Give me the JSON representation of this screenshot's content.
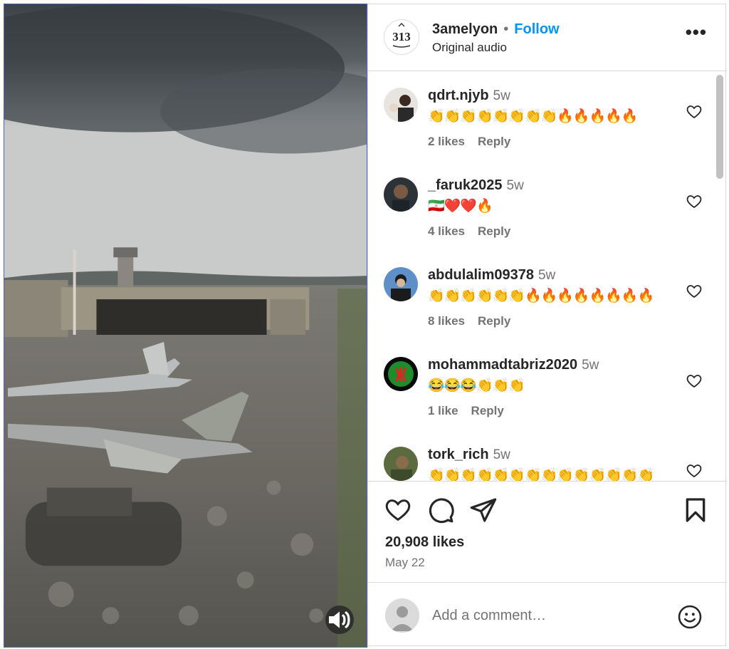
{
  "post": {
    "username": "3amelyon",
    "follow_label": "Follow",
    "audio": "Original audio",
    "avatar_text": "313",
    "likes": "20,908 likes",
    "date": "May 22"
  },
  "comments": [
    {
      "username": "qdrt.njyb",
      "time": "5w",
      "text": "👏👏👏👏👏👏👏👏🔥🔥🔥🔥🔥",
      "likes": "2 likes",
      "reply": "Reply"
    },
    {
      "username": "_faruk2025",
      "time": "5w",
      "text": "🇮🇷❤️❤️🔥",
      "likes": "4 likes",
      "reply": "Reply"
    },
    {
      "username": "abdulalim09378",
      "time": "5w",
      "text": "👏👏👏👏👏👏🔥🔥🔥🔥🔥🔥🔥🔥",
      "likes": "8 likes",
      "reply": "Reply"
    },
    {
      "username": "mohammadtabriz2020",
      "time": "5w",
      "text": "😂😂😂👏👏👏",
      "likes": "1 like",
      "reply": "Reply"
    },
    {
      "username": "tork_rich",
      "time": "5w",
      "text": "👏👏👏👏👏👏👏👏👏👏👏👏👏👏",
      "likes": "",
      "reply": ""
    }
  ],
  "add_comment": {
    "placeholder": "Add a comment…"
  },
  "colors": {
    "accent": "#0095f6",
    "muted": "#737373",
    "border": "#dbdbdb"
  }
}
